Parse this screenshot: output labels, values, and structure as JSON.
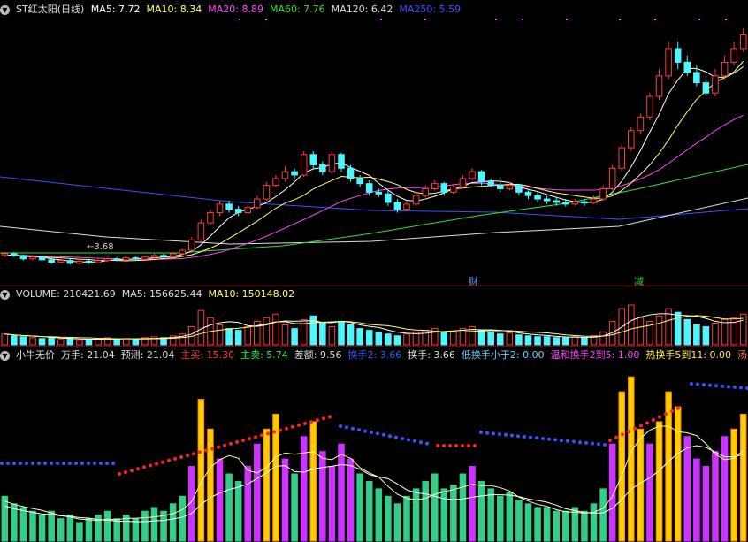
{
  "price_header": {
    "title": "ST红太阳(日线)",
    "items": [
      {
        "label": "MA5: 7.72",
        "color": "#ffffff"
      },
      {
        "label": "MA10: 8.34",
        "color": "#ffff66"
      },
      {
        "label": "MA20: 8.89",
        "color": "#ff44ff"
      },
      {
        "label": "MA60: 7.76",
        "color": "#33dd33"
      },
      {
        "label": "MA120: 6.42",
        "color": "#dddddd"
      },
      {
        "label": "MA250: 5.59",
        "color": "#3355ff"
      }
    ]
  },
  "price_panel": {
    "low_label": "3.68",
    "markers": [
      "财",
      "减"
    ]
  },
  "volume_header": {
    "items": [
      {
        "label": "VOLUME: 210421.69",
        "color": "#dddddd"
      },
      {
        "label": "MA5: 156625.44",
        "color": "#dddddd"
      },
      {
        "label": "MA10: 150148.02",
        "color": "#ffff66"
      }
    ]
  },
  "indicator_header": {
    "items": [
      {
        "label": "小牛无价",
        "color": "#dddddd"
      },
      {
        "label": "万手: 21.04",
        "color": "#dddddd"
      },
      {
        "label": "预测: 21.04",
        "color": "#dddddd"
      },
      {
        "label": "主买: 15.30",
        "color": "#ff3333"
      },
      {
        "label": "主卖: 5.74",
        "color": "#33ee33"
      },
      {
        "label": "差额: 9.56",
        "color": "#dddddd"
      },
      {
        "label": "换手2: 3.66",
        "color": "#3355ff"
      },
      {
        "label": "换手: 3.66",
        "color": "#dddddd"
      },
      {
        "label": "低换手小于2: 0.00",
        "color": "#66ccff"
      },
      {
        "label": "温和换手2到5: 1.00",
        "color": "#ff44ff"
      },
      {
        "label": "热换手5到11: 0.00",
        "color": "#ffee33"
      },
      {
        "label": "汤手",
        "color": "#ff7733"
      }
    ]
  },
  "chart_data": [
    {
      "type": "candlestick",
      "title": "ST红太阳(日线)",
      "ma_lines": [
        "MA5",
        "MA10",
        "MA20",
        "MA60",
        "MA120",
        "MA250"
      ],
      "ohlc": [
        [
          3.95,
          4.0,
          4.05,
          3.9
        ],
        [
          4.0,
          3.95,
          4.05,
          3.9
        ],
        [
          3.95,
          3.85,
          3.98,
          3.8
        ],
        [
          3.85,
          3.9,
          3.95,
          3.8
        ],
        [
          3.9,
          3.82,
          3.95,
          3.78
        ],
        [
          3.82,
          3.75,
          3.88,
          3.7
        ],
        [
          3.75,
          3.8,
          3.85,
          3.72
        ],
        [
          3.8,
          3.72,
          3.85,
          3.68
        ],
        [
          3.72,
          3.78,
          3.82,
          3.68
        ],
        [
          3.78,
          3.74,
          3.82,
          3.7
        ],
        [
          3.74,
          3.8,
          3.85,
          3.72
        ],
        [
          3.8,
          3.85,
          3.9,
          3.76
        ],
        [
          3.85,
          3.82,
          3.9,
          3.78
        ],
        [
          3.82,
          3.88,
          3.92,
          3.8
        ],
        [
          3.88,
          3.84,
          3.92,
          3.8
        ],
        [
          3.84,
          3.9,
          3.95,
          3.82
        ],
        [
          3.9,
          3.95,
          4.0,
          3.86
        ],
        [
          3.95,
          3.92,
          4.0,
          3.88
        ],
        [
          3.92,
          4.0,
          4.05,
          3.9
        ],
        [
          4.0,
          4.1,
          4.15,
          3.96
        ],
        [
          4.1,
          4.4,
          4.48,
          4.06
        ],
        [
          4.4,
          4.9,
          5.0,
          4.35
        ],
        [
          4.9,
          5.2,
          5.3,
          4.85
        ],
        [
          5.2,
          5.45,
          5.55,
          5.1
        ],
        [
          5.45,
          5.3,
          5.55,
          5.2
        ],
        [
          5.3,
          5.2,
          5.4,
          5.1
        ],
        [
          5.2,
          5.35,
          5.45,
          5.15
        ],
        [
          5.35,
          5.6,
          5.7,
          5.3
        ],
        [
          5.6,
          6.0,
          6.1,
          5.55
        ],
        [
          6.0,
          6.2,
          6.3,
          5.95
        ],
        [
          6.2,
          6.4,
          6.55,
          6.1
        ],
        [
          6.4,
          6.3,
          6.5,
          6.2
        ],
        [
          6.3,
          6.9,
          7.0,
          6.25
        ],
        [
          6.9,
          6.6,
          7.0,
          6.5
        ],
        [
          6.6,
          6.4,
          6.7,
          6.3
        ],
        [
          6.4,
          6.9,
          7.0,
          6.35
        ],
        [
          6.9,
          6.5,
          6.95,
          6.4
        ],
        [
          6.5,
          6.2,
          6.6,
          6.1
        ],
        [
          6.2,
          6.05,
          6.3,
          5.95
        ],
        [
          6.05,
          5.8,
          6.15,
          5.7
        ],
        [
          5.8,
          5.75,
          5.9,
          5.65
        ],
        [
          5.75,
          5.5,
          5.85,
          5.4
        ],
        [
          5.5,
          5.3,
          5.6,
          5.2
        ],
        [
          5.3,
          5.45,
          5.55,
          5.25
        ],
        [
          5.45,
          5.7,
          5.8,
          5.4
        ],
        [
          5.7,
          5.9,
          6.0,
          5.65
        ],
        [
          5.9,
          6.05,
          6.15,
          5.85
        ],
        [
          6.05,
          5.8,
          6.1,
          5.7
        ],
        [
          5.8,
          5.95,
          6.05,
          5.75
        ],
        [
          5.95,
          6.2,
          6.3,
          5.9
        ],
        [
          6.2,
          6.4,
          6.5,
          6.15
        ],
        [
          6.4,
          6.1,
          6.45,
          6.0
        ],
        [
          6.1,
          6.0,
          6.2,
          5.95
        ],
        [
          6.0,
          5.9,
          6.1,
          5.8
        ],
        [
          5.9,
          6.0,
          6.1,
          5.85
        ],
        [
          6.0,
          5.8,
          6.05,
          5.7
        ],
        [
          5.8,
          5.7,
          5.85,
          5.6
        ],
        [
          5.7,
          5.6,
          5.8,
          5.5
        ],
        [
          5.6,
          5.55,
          5.7,
          5.45
        ],
        [
          5.55,
          5.5,
          5.65,
          5.4
        ],
        [
          5.5,
          5.45,
          5.6,
          5.38
        ],
        [
          5.45,
          5.52,
          5.6,
          5.4
        ],
        [
          5.52,
          5.48,
          5.6,
          5.4
        ],
        [
          5.48,
          5.6,
          5.7,
          5.45
        ],
        [
          5.6,
          5.9,
          6.0,
          5.55
        ],
        [
          5.9,
          6.5,
          6.6,
          5.85
        ],
        [
          6.5,
          7.1,
          7.2,
          6.4
        ],
        [
          7.1,
          7.6,
          7.7,
          7.0
        ],
        [
          7.6,
          8.0,
          8.1,
          7.5
        ],
        [
          8.0,
          8.6,
          8.7,
          7.9
        ],
        [
          8.6,
          9.2,
          9.4,
          8.5
        ],
        [
          9.2,
          10.0,
          10.2,
          9.1
        ],
        [
          10.0,
          9.6,
          10.2,
          9.4
        ],
        [
          9.6,
          9.3,
          9.8,
          9.2
        ],
        [
          9.3,
          9.0,
          9.5,
          8.9
        ],
        [
          9.0,
          8.7,
          9.2,
          8.6
        ],
        [
          8.7,
          9.2,
          9.4,
          8.6
        ],
        [
          9.2,
          9.6,
          9.8,
          9.1
        ],
        [
          9.6,
          10.0,
          10.2,
          9.5
        ],
        [
          10.0,
          10.4,
          10.6,
          9.9
        ]
      ],
      "ma5": [
        3.95,
        3.96,
        3.93,
        3.91,
        3.9,
        3.85,
        3.82,
        3.78,
        3.76,
        3.76,
        3.76,
        3.8,
        3.82,
        3.83,
        3.85,
        3.86,
        3.88,
        3.9,
        3.92,
        3.98,
        4.07,
        4.26,
        4.52,
        4.79,
        5.05,
        5.21,
        5.3,
        5.38,
        5.49,
        5.67,
        5.87,
        6.1,
        6.36,
        6.48,
        6.52,
        6.62,
        6.66,
        6.52,
        6.41,
        6.29,
        6.06,
        5.86,
        5.68,
        5.56,
        5.54,
        5.6,
        5.68,
        5.78,
        5.9,
        5.98,
        6.08,
        6.1,
        6.13,
        6.12,
        6.08,
        5.96,
        5.88,
        5.82,
        5.73,
        5.65,
        5.57,
        5.52,
        5.49,
        5.51,
        5.59,
        5.8,
        6.12,
        6.54,
        7.02,
        7.56,
        8.08,
        8.68,
        9.08,
        9.42,
        9.42,
        9.32,
        9.16,
        9.16,
        9.32,
        9.63
      ],
      "ma10": [
        3.95,
        3.96,
        3.94,
        3.92,
        3.91,
        3.89,
        3.88,
        3.86,
        3.84,
        3.83,
        3.8,
        3.81,
        3.8,
        3.79,
        3.8,
        3.81,
        3.83,
        3.86,
        3.88,
        3.92,
        3.97,
        4.06,
        4.16,
        4.29,
        4.45,
        4.61,
        4.78,
        4.95,
        5.14,
        5.33,
        5.48,
        5.58,
        5.71,
        5.89,
        6.02,
        6.14,
        6.26,
        6.24,
        6.22,
        6.24,
        6.18,
        6.11,
        6.02,
        5.88,
        5.79,
        5.75,
        5.77,
        5.83,
        5.9,
        5.92,
        5.95,
        5.97,
        5.99,
        6.01,
        6.03,
        6.03,
        5.98,
        5.91,
        5.84,
        5.78,
        5.74,
        5.7,
        5.66,
        5.62,
        5.62,
        5.69,
        5.85,
        6.07,
        6.32,
        6.6,
        6.94,
        7.32,
        7.76,
        8.15,
        8.51,
        8.76,
        9.01,
        9.15,
        9.28,
        9.47
      ],
      "ma20": [
        3.95,
        3.95,
        3.95,
        3.94,
        3.93,
        3.92,
        3.91,
        3.9,
        3.89,
        3.88,
        3.87,
        3.86,
        3.85,
        3.84,
        3.84,
        3.84,
        3.84,
        3.84,
        3.85,
        3.86,
        3.89,
        3.93,
        3.98,
        4.04,
        4.12,
        4.21,
        4.3,
        4.4,
        4.51,
        4.63,
        4.75,
        4.88,
        5.0,
        5.13,
        5.26,
        5.39,
        5.53,
        5.62,
        5.7,
        5.78,
        5.85,
        5.89,
        5.92,
        5.93,
        5.93,
        5.94,
        5.95,
        5.98,
        6.02,
        6.05,
        6.06,
        6.06,
        6.05,
        6.02,
        6.0,
        5.98,
        5.95,
        5.92,
        5.89,
        5.87,
        5.86,
        5.86,
        5.86,
        5.86,
        5.88,
        5.92,
        5.99,
        6.08,
        6.19,
        6.31,
        6.46,
        6.64,
        6.84,
        7.04,
        7.23,
        7.41,
        7.6,
        7.77,
        7.92,
        8.05
      ]
    },
    {
      "type": "bar",
      "title": "VOLUME",
      "series": [
        {
          "name": "VOLUME",
          "values": [
            210421.69
          ]
        },
        {
          "name": "MA5",
          "values": [
            156625.44
          ]
        },
        {
          "name": "MA10",
          "values": [
            150148.02
          ]
        }
      ]
    }
  ]
}
